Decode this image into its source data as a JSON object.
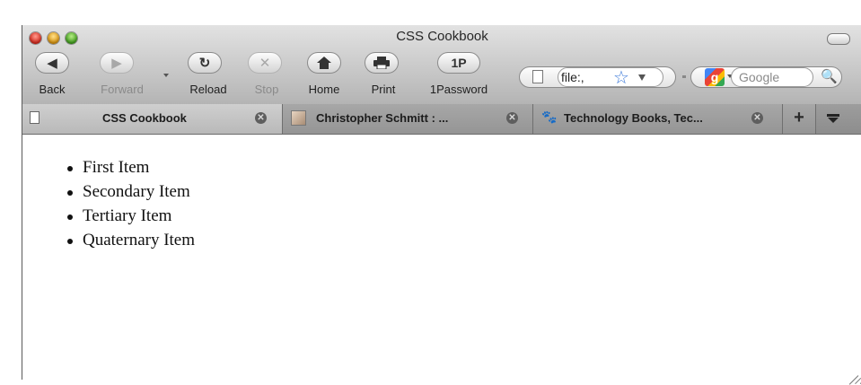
{
  "window": {
    "title": "CSS Cookbook"
  },
  "toolbar": {
    "back_label": "Back",
    "forward_label": "Forward",
    "reload_label": "Reload",
    "stop_label": "Stop",
    "home_label": "Home",
    "print_label": "Print",
    "onepassword_label": "1Password",
    "onepassword_glyph": "1P"
  },
  "address_bar": {
    "value": "file:,"
  },
  "search_bar": {
    "placeholder": "Google",
    "engine_glyph": "g"
  },
  "tabs": [
    {
      "label": "CSS Cookbook",
      "active": true,
      "icon": "page-icon"
    },
    {
      "label": "Christopher Schmitt : ...",
      "active": false,
      "icon": "photo-thumbnail-icon"
    },
    {
      "label": "Technology Books, Tec...",
      "active": false,
      "icon": "animal-favicon-icon"
    }
  ],
  "new_tab_glyph": "+",
  "content": {
    "list_items": [
      "First Item",
      "Secondary Item",
      "Tertiary Item",
      "Quaternary Item"
    ]
  },
  "colors": {
    "close_red": "#d6281c",
    "minimize_yellow": "#d9930c",
    "zoom_green": "#3f9e1c",
    "bookmark_star_blue": "#3a78d8"
  }
}
